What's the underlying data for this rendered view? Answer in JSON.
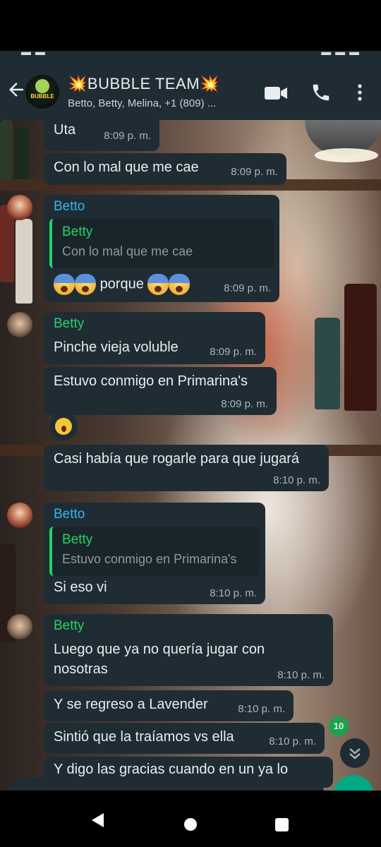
{
  "header": {
    "group_name": "💥BUBBLE TEAM💥",
    "participants": "Betto, Betty, Melina, +1 (809) ...",
    "avatar_logo_text": "BUBBLE",
    "icons": [
      "back-arrow-icon",
      "video-call-icon",
      "phone-call-icon",
      "more-vert-icon"
    ]
  },
  "messages": [
    {
      "text": "Uta",
      "time": "8:09 p. m."
    },
    {
      "text": "Con lo mal que me cae",
      "time": "8:09 p. m."
    },
    {
      "sender": "Betto",
      "quote_name": "Betty",
      "quote_text": "Con lo mal que me cae",
      "text": "porque",
      "time": "8:09 p. m."
    },
    {
      "sender": "Betty",
      "text": "Pinche vieja voluble",
      "time": "8:09 p. m."
    },
    {
      "text": "Estuvo conmigo en Primarina's",
      "time": "8:09 p. m."
    },
    {
      "text": "Casi había que rogarle para que jugará",
      "time": "8:10 p. m."
    },
    {
      "sender": "Betto",
      "quote_name": "Betty",
      "quote_text": "Estuvo conmigo en Primarina's",
      "text": "Si eso vi",
      "time": "8:10 p. m."
    },
    {
      "sender": "Betty",
      "text_line1": "Luego que ya no quería jugar con",
      "text_line2": "nosotras",
      "time": "8:10 p. m."
    },
    {
      "text": "Y se regreso a Lavender",
      "time": "8:10 p. m."
    },
    {
      "text": "Sintió que la traíamos vs ella",
      "time": "8:10 p. m."
    },
    {
      "text": "Y digo las gracias cuando en un ya lo"
    }
  ],
  "unread_count": "10",
  "colors": {
    "header": "#1f2c34",
    "bubble": "#1f2c34",
    "betto": "#34b7f1",
    "betty": "#25d366",
    "accent": "#00a884"
  }
}
